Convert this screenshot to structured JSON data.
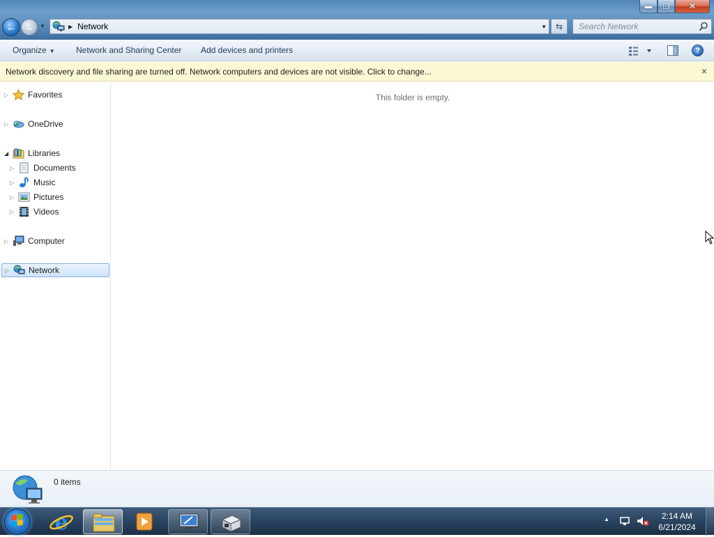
{
  "window": {
    "controls": {
      "minimize": "▬",
      "maximize": "❐",
      "close": "✕"
    }
  },
  "address_bar": {
    "location": "Network",
    "search_placeholder": "Search Network"
  },
  "command_bar": {
    "organize_label": "Organize",
    "network_sharing_label": "Network and Sharing Center",
    "add_devices_label": "Add devices and printers"
  },
  "info_bar": {
    "message": "Network discovery and file sharing are turned off. Network computers and devices are not visible. Click to change...",
    "close": "×"
  },
  "nav_pane": {
    "items": [
      {
        "label": "Favorites",
        "icon": "star-icon"
      },
      {
        "label": "OneDrive",
        "icon": "onedrive-icon"
      },
      {
        "label": "Libraries",
        "icon": "libraries-icon"
      },
      {
        "label": "Documents",
        "icon": "documents-icon"
      },
      {
        "label": "Music",
        "icon": "music-icon"
      },
      {
        "label": "Pictures",
        "icon": "pictures-icon"
      },
      {
        "label": "Videos",
        "icon": "videos-icon"
      },
      {
        "label": "Computer",
        "icon": "computer-icon"
      },
      {
        "label": "Network",
        "icon": "network-icon",
        "selected": true
      }
    ]
  },
  "content": {
    "empty_message": "This folder is empty."
  },
  "details_pane": {
    "item_count": "0 items"
  },
  "taskbar": {
    "apps": [
      {
        "name": "internet-explorer"
      },
      {
        "name": "windows-explorer",
        "active": true
      },
      {
        "name": "media-player"
      },
      {
        "name": "remote-desktop"
      },
      {
        "name": "setup-app"
      }
    ],
    "clock": {
      "time": "2:14 AM",
      "date": "6/21/2024"
    }
  },
  "colors": {
    "info_bar_bg": "#fbf8d6",
    "selection_bg": "#cde4fb",
    "taskbar_bg": "#2b4561"
  }
}
